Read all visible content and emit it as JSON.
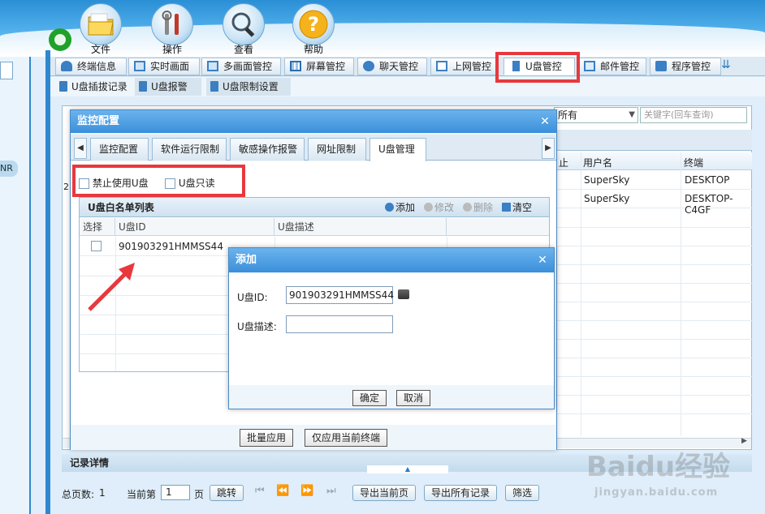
{
  "toolbar": {
    "buttons": [
      {
        "label": "文件",
        "icon": "folder-icon"
      },
      {
        "label": "操作",
        "icon": "tools-icon"
      },
      {
        "label": "查看",
        "icon": "magnifier-icon"
      },
      {
        "label": "帮助",
        "icon": "help-icon"
      }
    ]
  },
  "left_panel": {
    "label": "NR"
  },
  "main_tabs": [
    {
      "label": "终端信息"
    },
    {
      "label": "实时画面"
    },
    {
      "label": "多画面管控"
    },
    {
      "label": "屏幕管控"
    },
    {
      "label": "聊天管控"
    },
    {
      "label": "上网管控"
    },
    {
      "label": "U盘管控",
      "active": true
    },
    {
      "label": "邮件管控"
    },
    {
      "label": "程序管控"
    }
  ],
  "sub_tabs": [
    {
      "label": "U盘插拔记录"
    },
    {
      "label": "U盘报警"
    },
    {
      "label": "U盘限制设置"
    }
  ],
  "background_grid": {
    "filter_select": "所有",
    "keyword_placeholder": "关键字(回车查询)",
    "col_user": "用户名",
    "col_terminal": "终端",
    "partial_col": "止",
    "rows": [
      {
        "user": "SuperSky",
        "terminal": "DESKTOP"
      },
      {
        "user": "SuperSky",
        "terminal": "DESKTOP-C4GF"
      }
    ],
    "row_marker": "2"
  },
  "monitor_dialog": {
    "title": "监控配置",
    "tabs": [
      "监控配置",
      "软件运行限制",
      "敏感操作报警",
      "网址限制",
      "U盘管理"
    ],
    "active_tab": "U盘管理",
    "options": {
      "disable_usb": "禁止使用U盘",
      "usb_readonly": "U盘只读"
    },
    "whitelist": {
      "title": "U盘白名单列表",
      "toolbar": {
        "add": "添加",
        "edit": "修改",
        "delete": "删除",
        "clear": "清空"
      },
      "columns": {
        "select": "选择",
        "id": "U盘ID",
        "desc": "U盘描述"
      },
      "rows": [
        {
          "id": "901903291HMMSS44",
          "desc": ""
        }
      ]
    },
    "footer": {
      "apply_batch": "批量应用",
      "apply_current": "仅应用当前终端"
    }
  },
  "add_dialog": {
    "title": "添加",
    "id_label": "U盘ID:",
    "id_value": "901903291HMMSS44",
    "desc_label": "U盘描述:",
    "desc_value": "",
    "ok": "确定",
    "cancel": "取消"
  },
  "record_detail": {
    "title": "记录详情"
  },
  "pager": {
    "total_pages_label": "总页数:",
    "total_pages": "1",
    "current_label": "当前第",
    "current_page": "1",
    "page_suffix": "页",
    "jump": "跳转",
    "export_current": "导出当前页",
    "export_all": "导出所有记录",
    "filter": "筛选"
  },
  "watermark": {
    "logo": "Baidu经验",
    "url": "jingyan.baidu.com"
  },
  "colors": {
    "highlight": "#e8383d",
    "title_bar": "#3a8fda",
    "accent": "#2e88cf"
  }
}
